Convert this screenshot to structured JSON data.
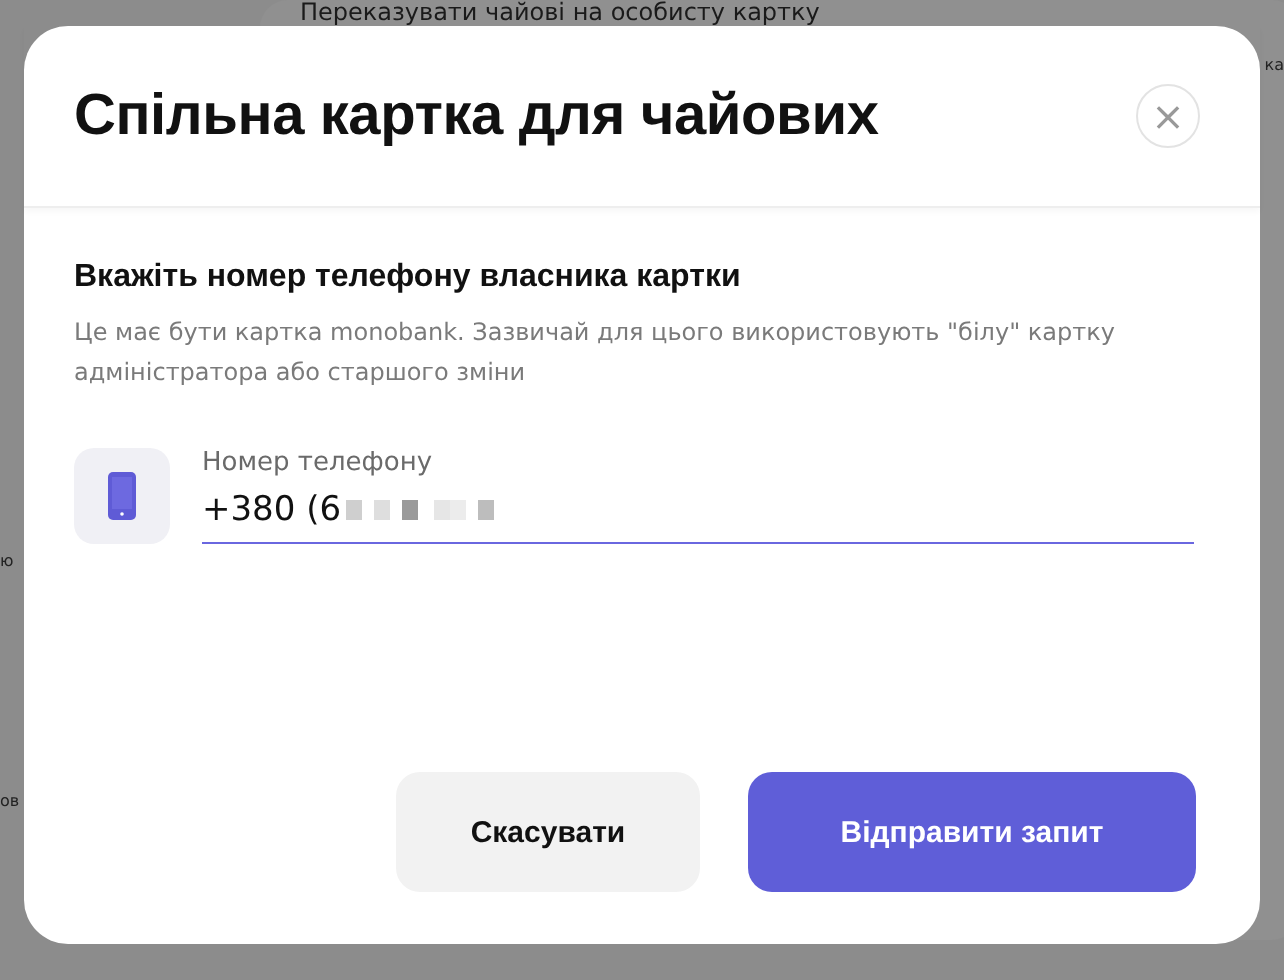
{
  "background": {
    "heading": "Переказувати чайові на особисту картку",
    "fragments": [
      "ка",
      "ю",
      "ов"
    ]
  },
  "dialog": {
    "title": "Спільна картка для чайових",
    "close": "×",
    "subtitle": "Вкажіть номер телефону власника картки",
    "description": "Це має бути картка monobank. Зазвичай для цього використовують \"білу\" картку адміністратора або старшого зміни",
    "phone_field": {
      "label": "Номер телефону",
      "value": "+380 (6",
      "redacted": true
    },
    "buttons": [
      {
        "label": "Скасувати",
        "kind": "secondary"
      },
      {
        "label": "Відправити запит",
        "kind": "primary"
      }
    ]
  }
}
